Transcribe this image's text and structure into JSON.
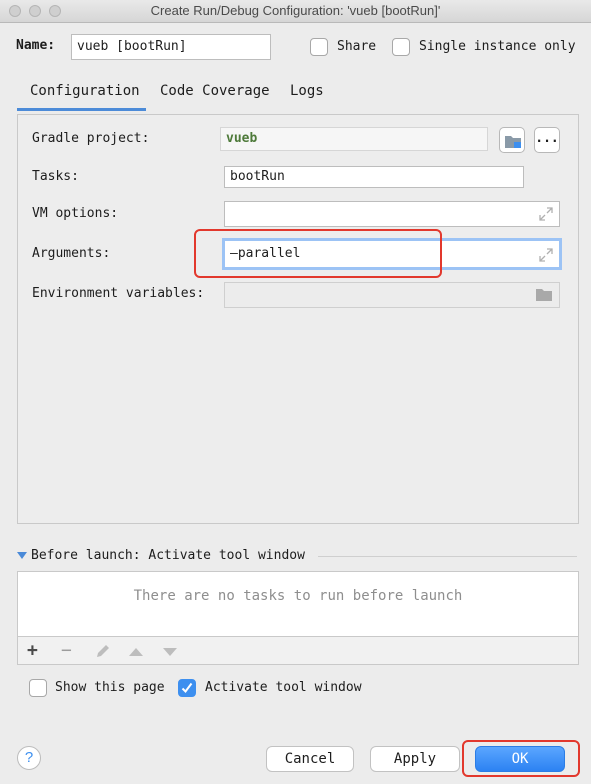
{
  "window": {
    "title": "Create Run/Debug Configuration: 'vueb [bootRun]'"
  },
  "name_row": {
    "label": "Name:",
    "value": "vueb [bootRun]",
    "share_label": "Share",
    "share_checked": false,
    "single_instance_label": "Single instance only",
    "single_instance_checked": false
  },
  "tabs": [
    {
      "label": "Configuration",
      "selected": true
    },
    {
      "label": "Code Coverage",
      "selected": false
    },
    {
      "label": "Logs",
      "selected": false
    }
  ],
  "configuration": {
    "gradle_project_label": "Gradle project:",
    "gradle_project_value": "vueb",
    "browse_button_label": "...",
    "tasks_label": "Tasks:",
    "tasks_value": "bootRun",
    "vm_options_label": "VM options:",
    "vm_options_value": "",
    "arguments_label": "Arguments:",
    "arguments_value": "—parallel",
    "env_vars_label": "Environment variables:",
    "env_vars_value": ""
  },
  "before_launch": {
    "header": "Before launch: Activate tool window",
    "empty_text": "There are no tasks to run before launch",
    "toolbar_icons": [
      "plus-icon",
      "minus-icon",
      "pencil-icon",
      "arrow-up-icon",
      "arrow-down-icon"
    ]
  },
  "options": {
    "show_page_label": "Show this page",
    "show_page_checked": false,
    "activate_tool_window_label": "Activate tool window",
    "activate_tool_window_checked": true
  },
  "footer": {
    "help_label": "?",
    "cancel_label": "Cancel",
    "apply_label": "Apply",
    "ok_label": "OK"
  },
  "colors": {
    "accent": "#3d8fef",
    "highlight": "#e2382d",
    "gradle_project_text": "#4e7a3a"
  }
}
